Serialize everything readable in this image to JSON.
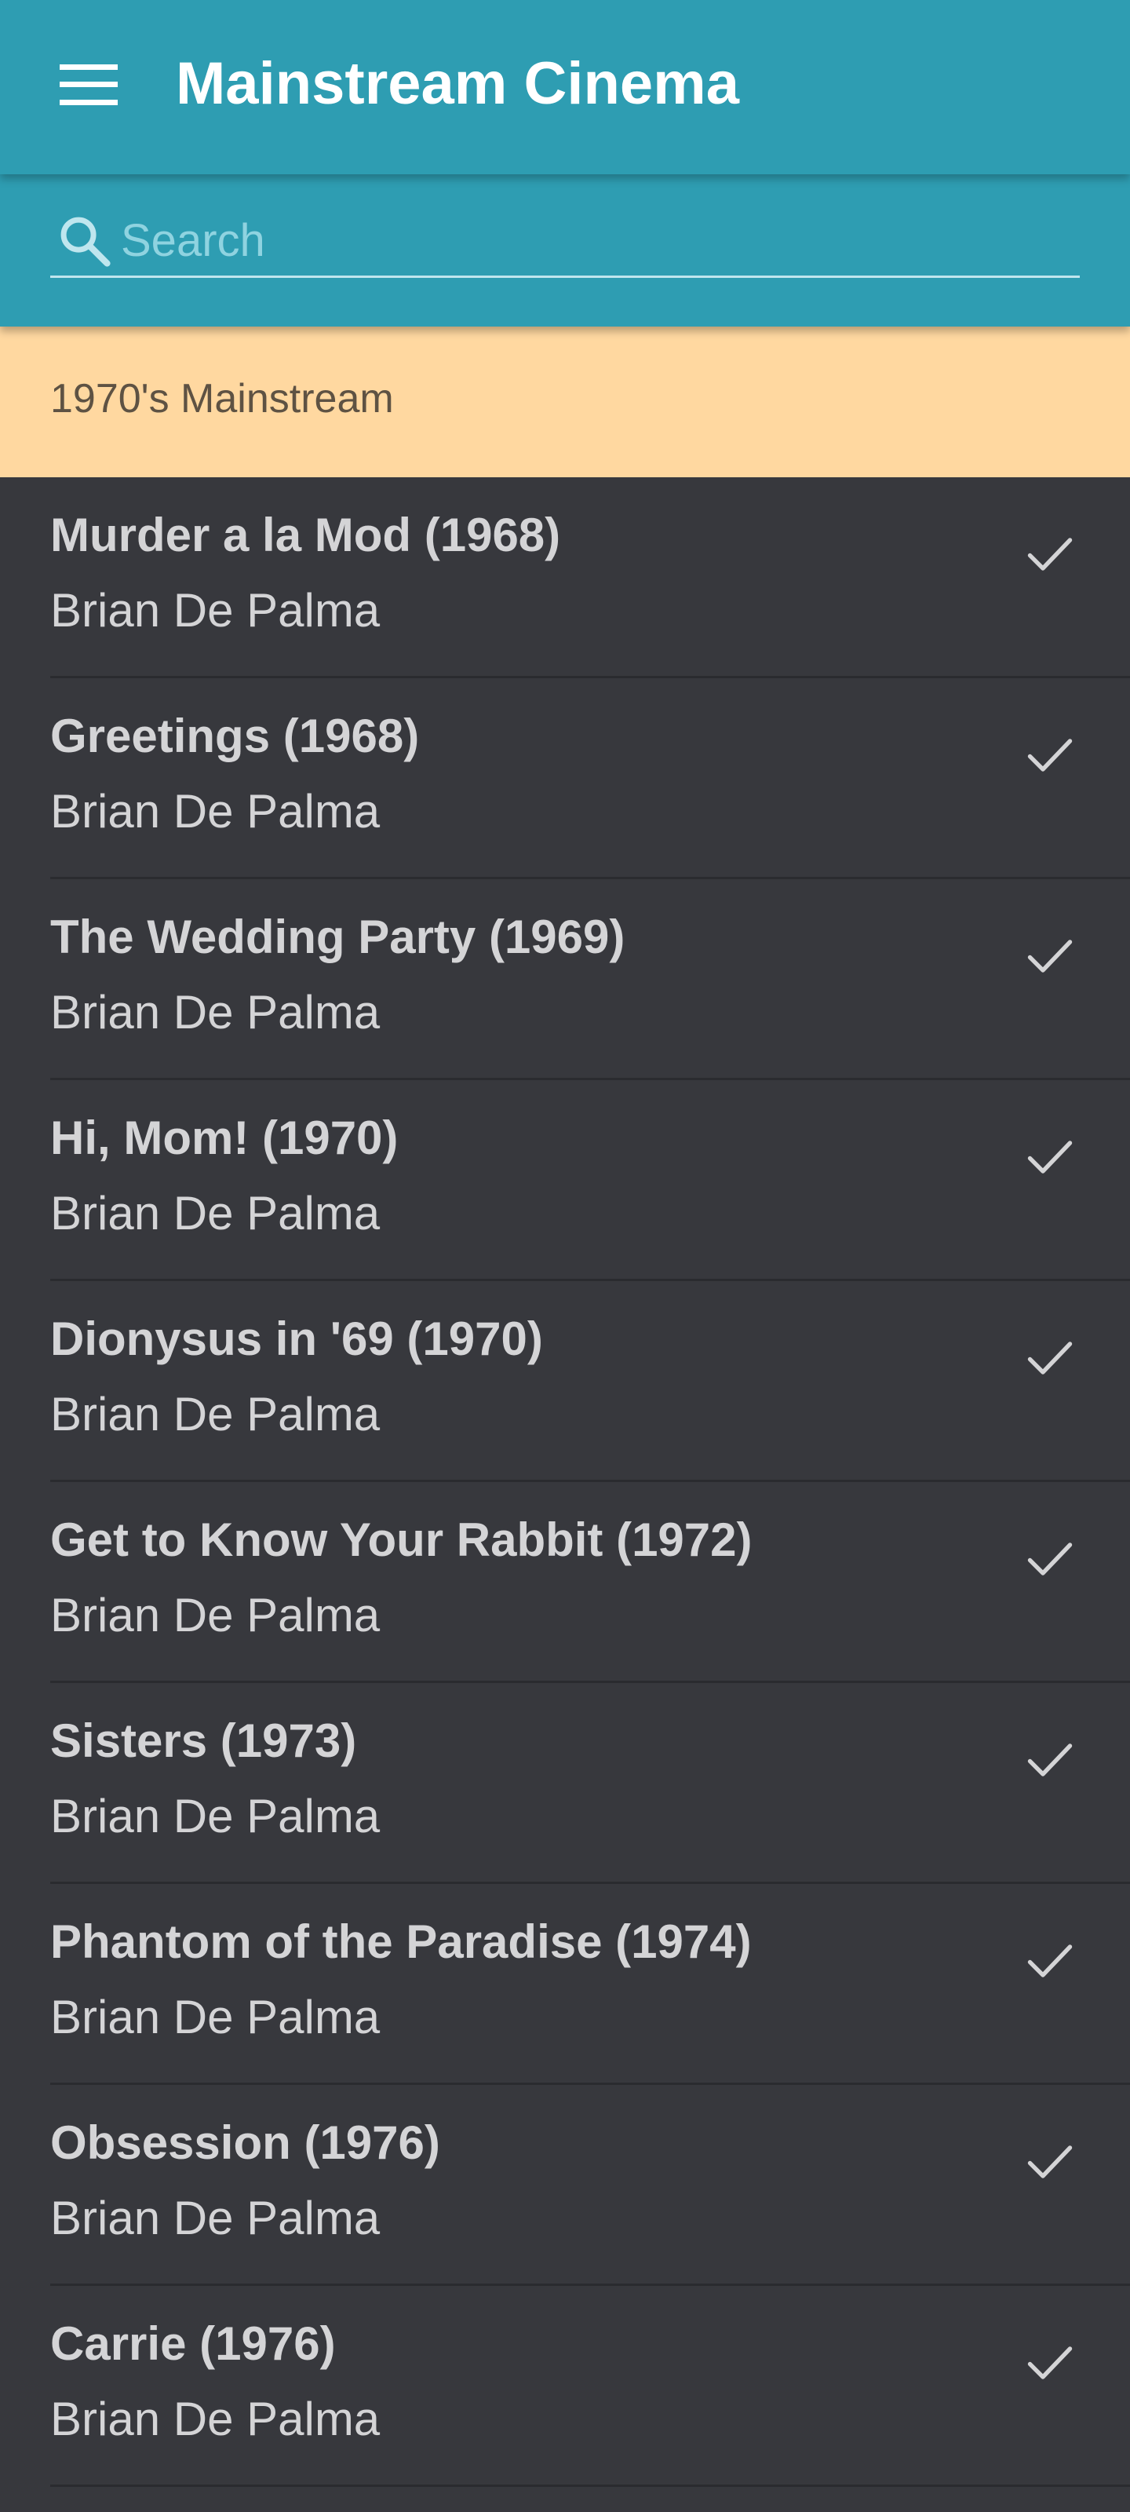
{
  "app": {
    "title": "Mainstream Cinema",
    "menu_icon": "menu-icon"
  },
  "search": {
    "placeholder": "Search",
    "value": "",
    "icon": "search-icon"
  },
  "section": {
    "label": "1970's Mainstream"
  },
  "colors": {
    "appbar": "#2e9db2",
    "section_bg": "#ffd8a0",
    "list_bg": "#37383d",
    "text": "#d4d4d6"
  },
  "movies": [
    {
      "title": "Murder a la Mod (1968)",
      "director": "Brian De Palma",
      "icon": "check-icon"
    },
    {
      "title": "Greetings (1968)",
      "director": "Brian De Palma",
      "icon": "check-icon"
    },
    {
      "title": "The Wedding Party (1969)",
      "director": "Brian De Palma",
      "icon": "check-icon"
    },
    {
      "title": "Hi, Mom! (1970)",
      "director": "Brian De Palma",
      "icon": "check-icon"
    },
    {
      "title": "Dionysus in '69 (1970)",
      "director": "Brian De Palma",
      "icon": "check-icon"
    },
    {
      "title": "Get to Know Your Rabbit (1972)",
      "director": "Brian De Palma",
      "icon": "check-icon"
    },
    {
      "title": "Sisters (1973)",
      "director": "Brian De Palma",
      "icon": "check-icon"
    },
    {
      "title": "Phantom of the Paradise (1974)",
      "director": "Brian De Palma",
      "icon": "check-icon"
    },
    {
      "title": "Obsession (1976)",
      "director": "Brian De Palma",
      "icon": "check-icon"
    },
    {
      "title": "Carrie (1976)",
      "director": "Brian De Palma",
      "icon": "check-icon"
    }
  ]
}
